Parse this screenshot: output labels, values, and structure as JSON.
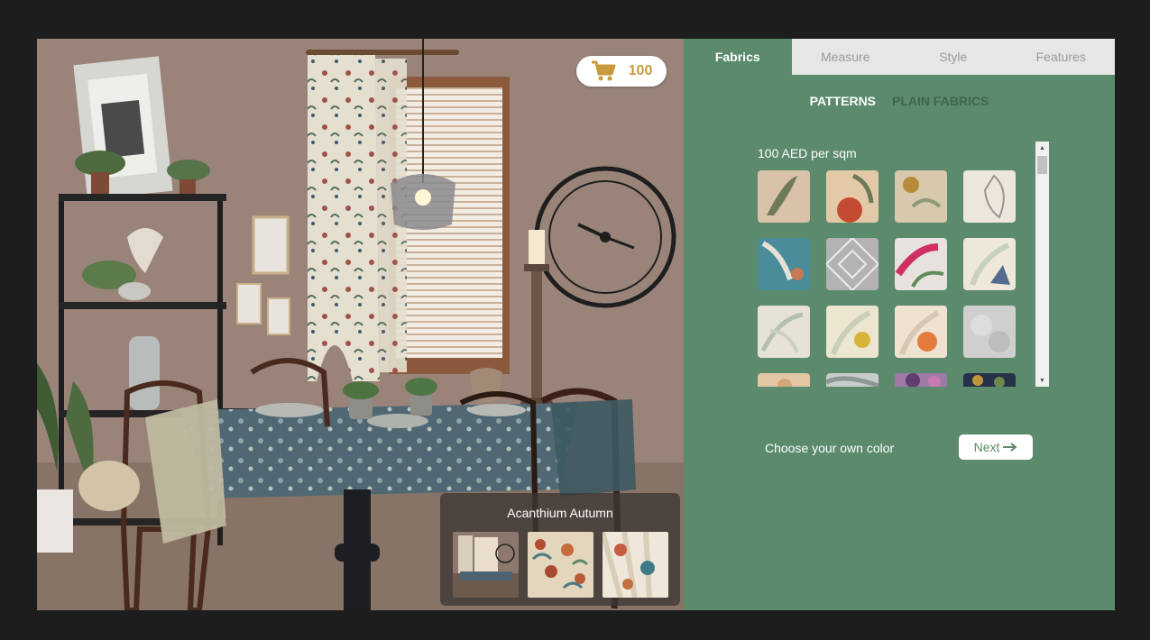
{
  "cart": {
    "count": "100",
    "icon": "cart-icon",
    "accent": "#c89a3d"
  },
  "tabs": [
    {
      "label": "Fabrics",
      "active": true
    },
    {
      "label": "Measure",
      "active": false
    },
    {
      "label": "Style",
      "active": false
    },
    {
      "label": "Features",
      "active": false
    }
  ],
  "subtabs": [
    {
      "label": "PATTERNS",
      "active": true
    },
    {
      "label": "PLAIN FABRICS",
      "active": false
    }
  ],
  "price_label": "100 AED per sqm",
  "own_color_label": "Choose your own color",
  "next_label": "Next",
  "next_icon": "arrow-right-icon",
  "selected_fabric": {
    "name": "Acanthium Autumn",
    "thumbnails": [
      "room-preview",
      "pattern-closeup",
      "fabric-drape"
    ]
  },
  "colors": {
    "panel": "#5b8a6d",
    "tab_bar": "#e6e6e6",
    "background": "#1d1d1d"
  }
}
